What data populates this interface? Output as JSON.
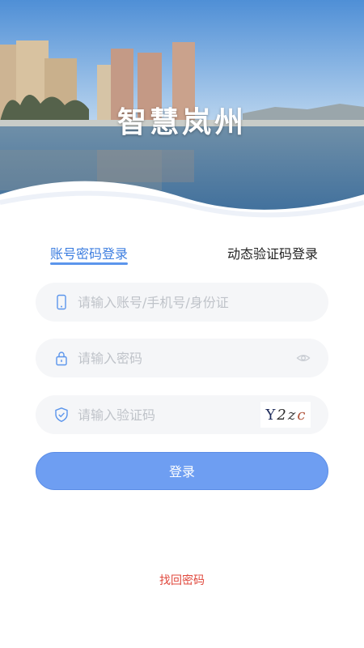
{
  "app": {
    "title": "智慧岚州"
  },
  "tabs": [
    {
      "label": "账号密码登录",
      "active": true
    },
    {
      "label": "动态验证码登录",
      "active": false
    }
  ],
  "form": {
    "account": {
      "placeholder": "请输入账号/手机号/身份证",
      "icon": "phone-icon"
    },
    "password": {
      "placeholder": "请输入密码",
      "icon": "lock-icon",
      "toggle_icon": "eye-icon"
    },
    "captcha": {
      "placeholder": "请输入验证码",
      "icon": "shield-icon",
      "code_chars": [
        "Y",
        "2",
        "z",
        "c"
      ]
    }
  },
  "login_button": {
    "label": "登录"
  },
  "forgot_password": {
    "label": "找回密码"
  },
  "colors": {
    "accent": "#3d7ee0",
    "button": "#6e9ef2",
    "forgot": "#e0483d",
    "input_bg": "#f5f6f8"
  }
}
